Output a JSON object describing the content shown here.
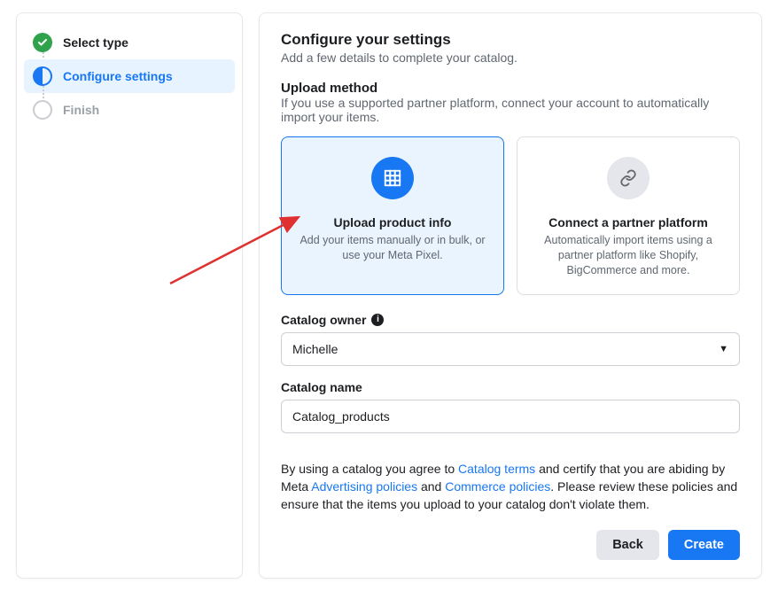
{
  "sidebar": {
    "steps": [
      {
        "label": "Select type"
      },
      {
        "label": "Configure settings"
      },
      {
        "label": "Finish"
      }
    ]
  },
  "header": {
    "title": "Configure your settings",
    "subtitle": "Add a few details to complete your catalog."
  },
  "upload_method": {
    "title": "Upload method",
    "desc": "If you use a supported partner platform, connect your account to automatically import your items.",
    "option_upload": {
      "title": "Upload product info",
      "desc": "Add your items manually or in bulk, or use your Meta Pixel."
    },
    "option_partner": {
      "title": "Connect a partner platform",
      "desc": "Automatically import items using a partner platform like Shopify, BigCommerce and more."
    }
  },
  "catalog_owner": {
    "label": "Catalog owner",
    "value": "Michelle"
  },
  "catalog_name": {
    "label": "Catalog name",
    "value": "Catalog_products"
  },
  "legal": {
    "prefix": "By using a catalog you agree to ",
    "link_terms": "Catalog terms",
    "mid1": " and certify that you are abiding by Meta ",
    "link_ads": "Advertising policies",
    "mid2": " and ",
    "link_commerce": "Commerce policies",
    "suffix": ". Please review these policies and ensure that the items you upload to your catalog don't violate them."
  },
  "footer": {
    "back": "Back",
    "create": "Create"
  }
}
